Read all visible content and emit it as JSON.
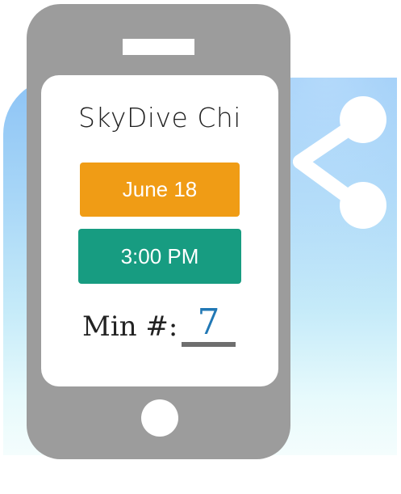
{
  "app": {
    "title": "SkyDive Chi"
  },
  "date_button": {
    "label": "June 18"
  },
  "time_button": {
    "label": "3:00 PM"
  },
  "min_field": {
    "label": "Min #:",
    "value": "7"
  },
  "icons": {
    "share": "share-icon",
    "home": "home-button",
    "speaker": "phone-speaker"
  },
  "colors": {
    "date_button": "#f09c15",
    "time_button": "#179c81",
    "min_value": "#2178b5",
    "phone_body": "#9c9c9c",
    "sky_top": "#8dc3f5"
  }
}
